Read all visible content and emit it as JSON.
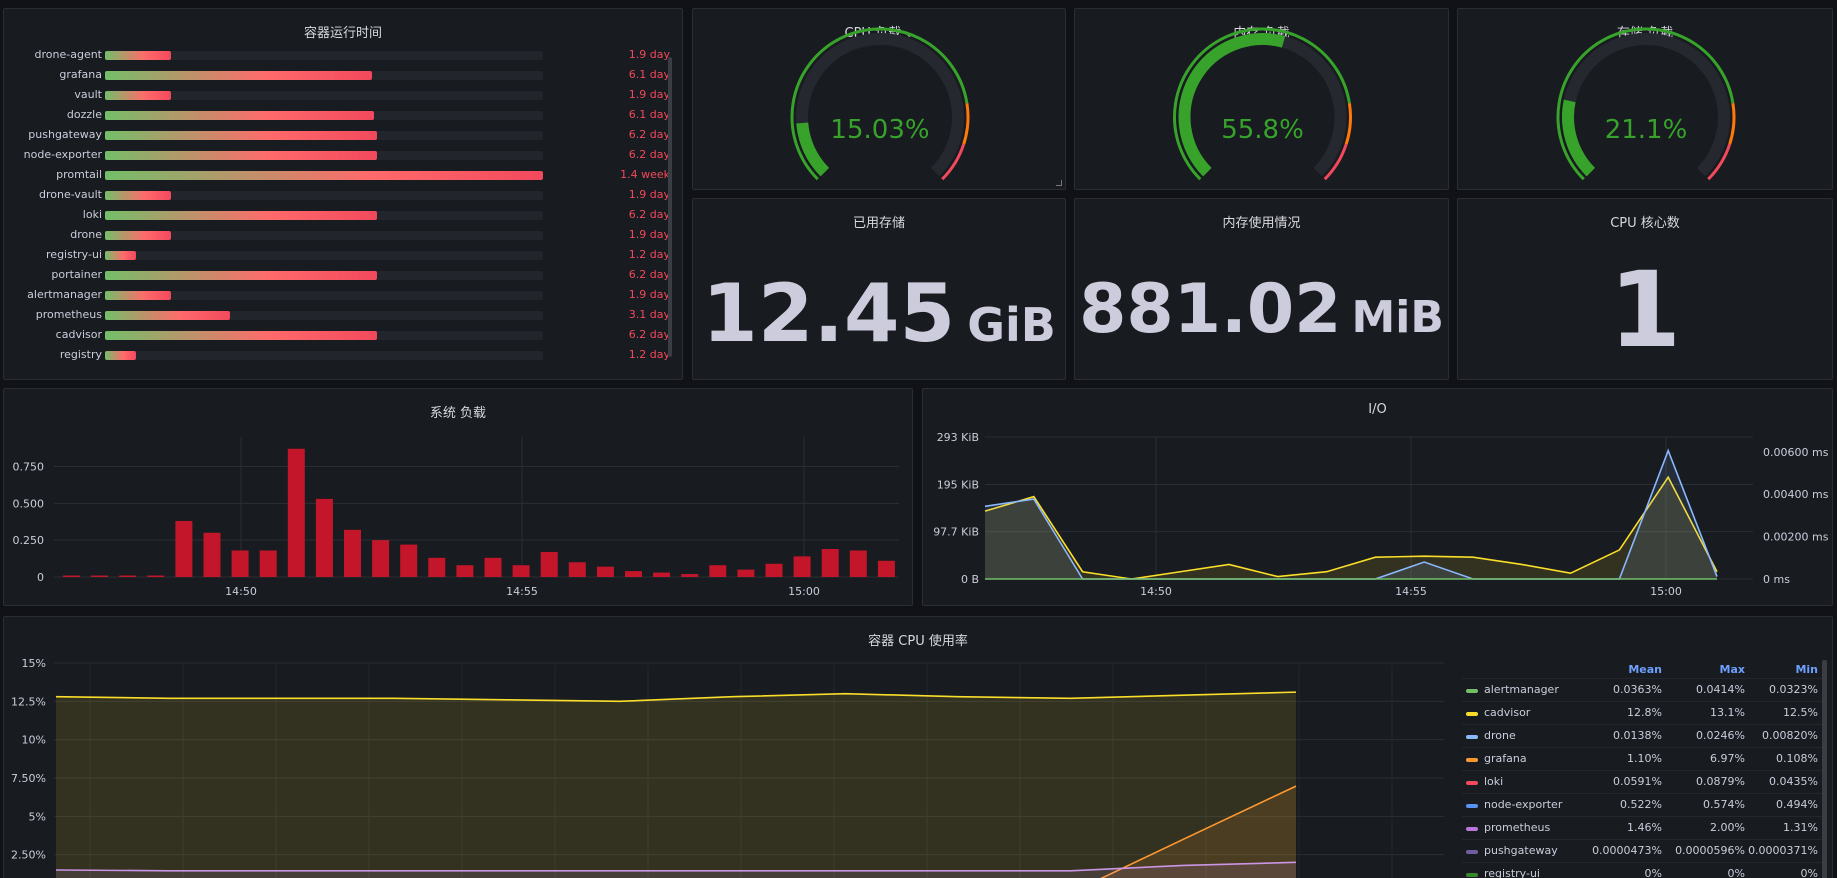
{
  "uptime": {
    "title": "容器运行时间",
    "rows": [
      {
        "name": "drone-agent",
        "value": "1.9 day",
        "fraction": 0.15
      },
      {
        "name": "grafana",
        "value": "6.1 day",
        "fraction": 0.61
      },
      {
        "name": "vault",
        "value": "1.9 day",
        "fraction": 0.15
      },
      {
        "name": "dozzle",
        "value": "6.1 day",
        "fraction": 0.615
      },
      {
        "name": "pushgateway",
        "value": "6.2 day",
        "fraction": 0.62
      },
      {
        "name": "node-exporter",
        "value": "6.2 day",
        "fraction": 0.62
      },
      {
        "name": "promtail",
        "value": "1.4 week",
        "fraction": 1.0
      },
      {
        "name": "drone-vault",
        "value": "1.9 day",
        "fraction": 0.15
      },
      {
        "name": "loki",
        "value": "6.2 day",
        "fraction": 0.62
      },
      {
        "name": "drone",
        "value": "1.9 day",
        "fraction": 0.15
      },
      {
        "name": "registry-ui",
        "value": "1.2 day",
        "fraction": 0.07
      },
      {
        "name": "portainer",
        "value": "6.2 day",
        "fraction": 0.62
      },
      {
        "name": "alertmanager",
        "value": "1.9 day",
        "fraction": 0.15
      },
      {
        "name": "prometheus",
        "value": "3.1 day",
        "fraction": 0.285
      },
      {
        "name": "cadvisor",
        "value": "6.2 day",
        "fraction": 0.62
      },
      {
        "name": "registry",
        "value": "1.2 day",
        "fraction": 0.07
      }
    ]
  },
  "gauges": [
    {
      "title": "CPU 负载",
      "chevron": "⌄",
      "value_text": "15.03%",
      "value": 15.03,
      "color": "#37a32b"
    },
    {
      "title": "内存 负载",
      "chevron": "",
      "value_text": "55.8%",
      "value": 55.8,
      "color": "#37a32b"
    },
    {
      "title": "存储 负载",
      "chevron": "",
      "value_text": "21.1%",
      "value": 21.1,
      "color": "#37a32b"
    }
  ],
  "stats": [
    {
      "title": "已用存储",
      "value": "12.45",
      "unit": "GiB"
    },
    {
      "title": "内存使用情况",
      "value": "881.02",
      "unit": "MiB"
    },
    {
      "title": "CPU 核心数",
      "value": "1",
      "unit": ""
    }
  ],
  "sysload": {
    "title": "系统 负载",
    "chart_data": {
      "type": "bar",
      "title": "系统 负载",
      "y_ticks": [
        "0.750",
        "0.500",
        "0.250",
        "0"
      ],
      "x_ticks": [
        "14:50",
        "14:55",
        "15:00"
      ],
      "ylim": [
        0,
        0.95
      ],
      "values": [
        0.01,
        0.01,
        0.01,
        0.01,
        0.38,
        0.3,
        0.18,
        0.18,
        0.87,
        0.53,
        0.32,
        0.25,
        0.22,
        0.13,
        0.08,
        0.13,
        0.08,
        0.17,
        0.1,
        0.07,
        0.04,
        0.03,
        0.02,
        0.08,
        0.05,
        0.09,
        0.14,
        0.19,
        0.18,
        0.11
      ],
      "color": "#c4162a"
    }
  },
  "io": {
    "title": "I/O",
    "chart_data": {
      "type": "line",
      "title": "I/O",
      "y_left_ticks": [
        "293 KiB",
        "195 KiB",
        "97.7 KiB",
        "0 B"
      ],
      "y_right_ticks": [
        "0.00600 ms",
        "0.00400 ms",
        "0.00200 ms",
        "0 ms"
      ],
      "x_ticks": [
        "14:50",
        "14:55",
        "15:00"
      ],
      "ylim": [
        0,
        293
      ],
      "series": [
        {
          "color": "#fade2a",
          "values": [
            140,
            170,
            15,
            0,
            15,
            30,
            5,
            15,
            45,
            47,
            45,
            30,
            12,
            60,
            210,
            15
          ]
        },
        {
          "color": "#8ab8ff",
          "values": [
            150,
            165,
            0,
            0,
            0,
            0,
            0,
            0,
            0,
            35,
            0,
            0,
            0,
            0,
            265,
            5
          ]
        },
        {
          "color": "#73bf69",
          "values": [
            0,
            0,
            0,
            0,
            0,
            0,
            0,
            0,
            0,
            0,
            0,
            0,
            0,
            0,
            0,
            0
          ]
        }
      ]
    }
  },
  "cpu_usage": {
    "title": "容器 CPU 使用率",
    "chart_data": {
      "type": "line",
      "title": "容器 CPU 使用率",
      "y_ticks": [
        "15%",
        "12.5%",
        "10%",
        "7.50%",
        "5%",
        "2.50%"
      ],
      "ylim": [
        0,
        15
      ],
      "series": [
        {
          "name": "cadvisor",
          "color": "#fade2a",
          "values": [
            12.8,
            12.7,
            12.7,
            12.7,
            12.6,
            12.5,
            12.8,
            13.0,
            12.8,
            12.7,
            12.9,
            13.1
          ]
        },
        {
          "name": "grafana",
          "color": "#ff9830",
          "values": [
            null,
            null,
            null,
            null,
            null,
            null,
            null,
            null,
            null,
            0.0,
            3.5,
            6.97
          ]
        },
        {
          "name": "prometheus",
          "color": "#ca95e5",
          "values": [
            1.5,
            1.45,
            1.45,
            1.45,
            1.45,
            1.45,
            1.45,
            1.45,
            1.45,
            1.45,
            1.8,
            2.0
          ]
        },
        {
          "name": "node-exporter",
          "color": "#5794f2",
          "values": [
            0.52,
            0.52,
            0.52,
            0.52,
            0.52,
            0.52,
            0.52,
            0.52,
            0.52,
            0.52,
            0.52,
            0.52
          ]
        }
      ]
    },
    "legend": {
      "headers": [
        "Mean",
        "Max",
        "Min"
      ],
      "rows": [
        {
          "name": "alertmanager",
          "color": "#73bf69",
          "mean": "0.0363%",
          "max": "0.0414%",
          "min": "0.0323%"
        },
        {
          "name": "cadvisor",
          "color": "#fade2a",
          "mean": "12.8%",
          "max": "13.1%",
          "min": "12.5%"
        },
        {
          "name": "drone",
          "color": "#8ab8ff",
          "mean": "0.0138%",
          "max": "0.0246%",
          "min": "0.00820%"
        },
        {
          "name": "grafana",
          "color": "#ff9830",
          "mean": "1.10%",
          "max": "6.97%",
          "min": "0.108%"
        },
        {
          "name": "loki",
          "color": "#f2495c",
          "mean": "0.0591%",
          "max": "0.0879%",
          "min": "0.0435%"
        },
        {
          "name": "node-exporter",
          "color": "#5794f2",
          "mean": "0.522%",
          "max": "0.574%",
          "min": "0.494%"
        },
        {
          "name": "prometheus",
          "color": "#b877d9",
          "mean": "1.46%",
          "max": "2.00%",
          "min": "1.31%"
        },
        {
          "name": "pushgateway",
          "color": "#705da0",
          "mean": "0.0000473%",
          "max": "0.0000596%",
          "min": "0.0000371%"
        },
        {
          "name": "registry-ui",
          "color": "#37872d",
          "mean": "0%",
          "max": "0%",
          "min": "0%"
        }
      ]
    }
  }
}
